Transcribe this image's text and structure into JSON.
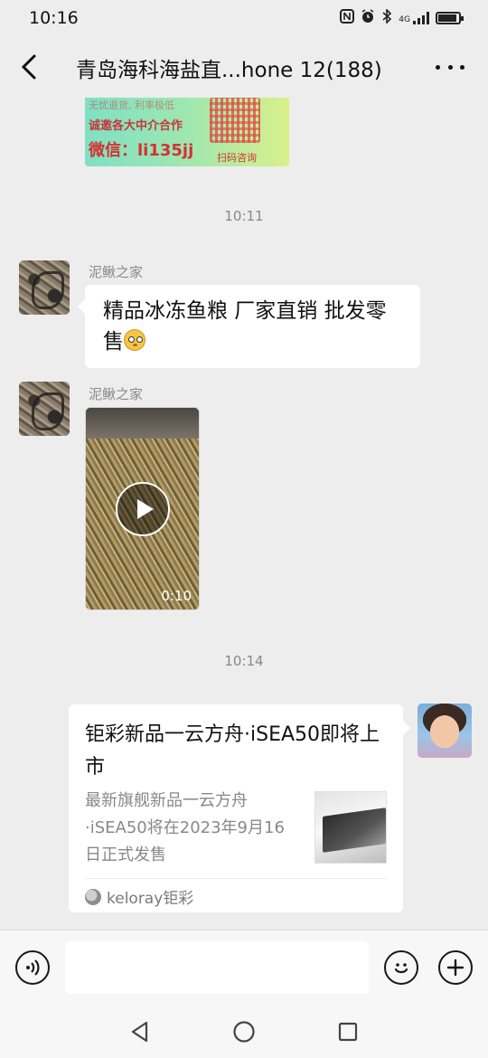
{
  "status_bar": {
    "time": "10:16",
    "icons": [
      "nfc-icon",
      "alarm-icon",
      "bluetooth-icon",
      "signal-4g-icon",
      "battery-icon"
    ],
    "network": "4G",
    "battery_level": 0.85
  },
  "header": {
    "title": "青岛海科海盐直...hone 12(188)"
  },
  "messages": {
    "top_image": {
      "line1": "无忧退货, 利率极低",
      "line2": "诚邀各大中介合作",
      "line3": "微信：li135jj",
      "line4": "扫码咨询"
    },
    "time_1": "10:11",
    "msg1": {
      "sender": "泥鳅之家",
      "text": "精品冰冻鱼粮 厂家直销 批发零售"
    },
    "msg2": {
      "sender": "泥鳅之家",
      "video_duration": "0:10"
    },
    "time_2": "10:14",
    "card": {
      "title": "钜彩新品一云方舟·iSEA50即将上市",
      "description": "最新旗舰新品一云方舟·iSEA50将在2023年9月16日正式发售",
      "source": "keloray钜彩"
    }
  },
  "input_bar": {
    "placeholder": ""
  },
  "colors": {
    "background": "#ededed",
    "bubble": "#ffffff",
    "meta_text": "#888888"
  }
}
